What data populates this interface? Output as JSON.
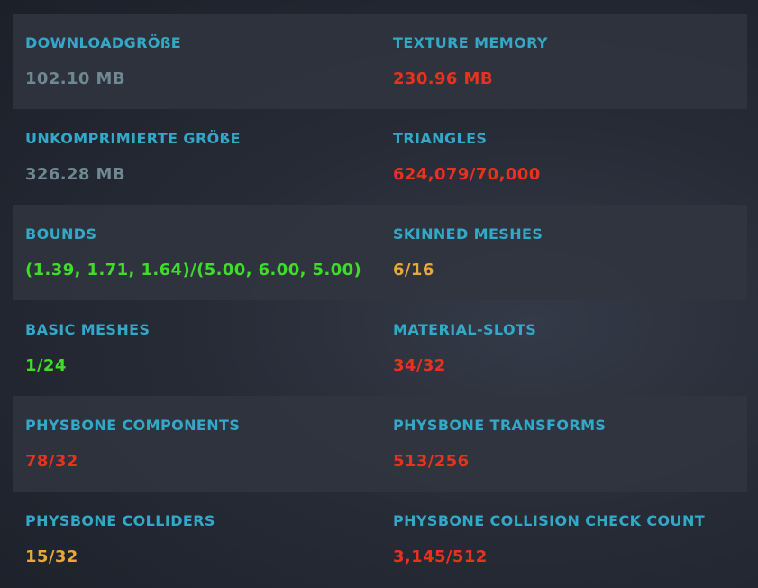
{
  "colors": {
    "label": "#34a8c8",
    "neutral": "#6f8892",
    "good": "#3fdc2a",
    "medium": "#e8a83a",
    "poor": "#e8321e"
  },
  "stats": [
    {
      "left": {
        "label": "DOWNLOADGRÖßE",
        "value": "102.10 MB",
        "status": "neutral"
      },
      "right": {
        "label": "TEXTURE MEMORY",
        "value": "230.96 MB",
        "status": "poor"
      }
    },
    {
      "left": {
        "label": "UNKOMPRIMIERTE GRÖßE",
        "value": "326.28 MB",
        "status": "neutral"
      },
      "right": {
        "label": "TRIANGLES",
        "value": "624,079/70,000",
        "status": "poor"
      }
    },
    {
      "left": {
        "label": "BOUNDS",
        "value": "(1.39, 1.71, 1.64)/(5.00, 6.00, 5.00)",
        "status": "good"
      },
      "right": {
        "label": "SKINNED MESHES",
        "value": "6/16",
        "status": "medium"
      }
    },
    {
      "left": {
        "label": "BASIC MESHES",
        "value": "1/24",
        "status": "good"
      },
      "right": {
        "label": "MATERIAL-SLOTS",
        "value": "34/32",
        "status": "poor"
      }
    },
    {
      "left": {
        "label": "PHYSBONE COMPONENTS",
        "value": "78/32",
        "status": "poor"
      },
      "right": {
        "label": "PHYSBONE TRANSFORMS",
        "value": "513/256",
        "status": "poor"
      }
    },
    {
      "left": {
        "label": "PHYSBONE COLLIDERS",
        "value": "15/32",
        "status": "medium"
      },
      "right": {
        "label": "PHYSBONE COLLISION CHECK COUNT",
        "value": "3,145/512",
        "status": "poor"
      }
    }
  ]
}
